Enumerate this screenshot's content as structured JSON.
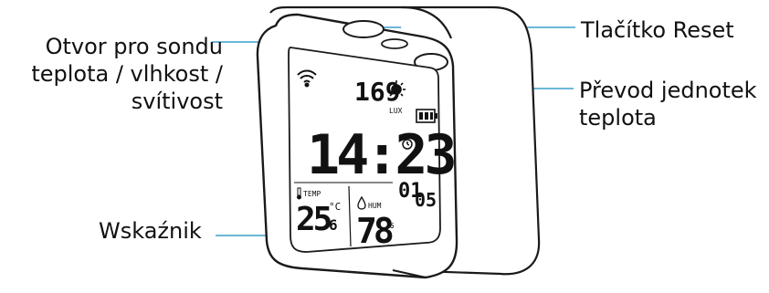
{
  "labels": {
    "probe_line1": "Otvor pro sondu",
    "probe_line2": "teplota / vlhkost /",
    "probe_line3": "svítivost",
    "reset": "Tlačítko Reset",
    "units_line1": "Převod jednotek",
    "units_line2": "teplota",
    "indicator": "Wskaźnik"
  },
  "display": {
    "lux_value": "169",
    "lux_unit": "LUX",
    "time": "14:23",
    "date_month": "01",
    "date_day": "05",
    "temp_label": "TEMP",
    "temp_int": "25",
    "temp_dec": "6",
    "temp_unit": "°C",
    "hum_label": "HUM",
    "hum_value": "78",
    "hum_unit": "%"
  },
  "colors": {
    "leader_line": "#3aa0c8",
    "outline": "#1a1a1a"
  }
}
